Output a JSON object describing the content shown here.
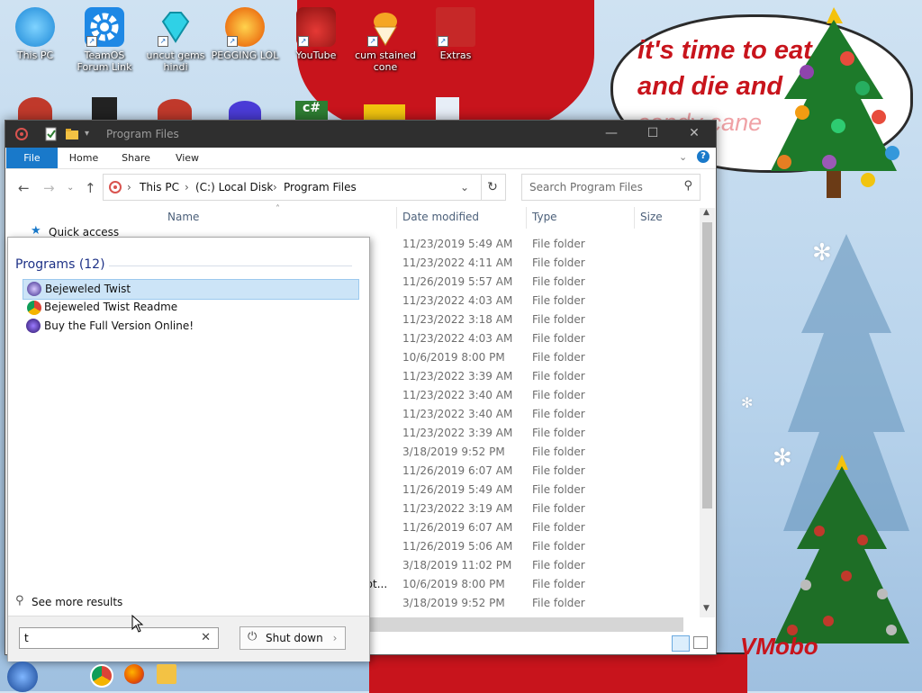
{
  "desktop": {
    "icons": [
      {
        "label": "This PC"
      },
      {
        "label": "TeamOS Forum Link"
      },
      {
        "label": "uncut gems hindi"
      },
      {
        "label": "PEGGING LOL"
      },
      {
        "label": "YouTube"
      },
      {
        "label": "cum stained cone"
      },
      {
        "label": "Extras"
      }
    ],
    "wallpaper_bubble_line1": "it's time to eat it",
    "wallpaper_bubble_line2": "and die and ...",
    "wallpaper_bubble_line3": "candy cane",
    "wallpaper_corner_text": "VMobo",
    "colors": {
      "hat_red": "#c8141c",
      "sky": "#cfe2f2"
    }
  },
  "explorer": {
    "title": "Program Files",
    "ribbon_tabs": [
      {
        "label": "File"
      },
      {
        "label": "Home"
      },
      {
        "label": "Share"
      },
      {
        "label": "View"
      }
    ],
    "address_segments": [
      {
        "label": "This PC"
      },
      {
        "label": "(C:) Local Disk"
      },
      {
        "label": "Program Files"
      }
    ],
    "search_placeholder": "Search Program Files",
    "nav_quick_access": "Quick access",
    "columns": {
      "name": "Name",
      "date": "Date modified",
      "type": "Type",
      "size": "Size"
    },
    "partial_name": "rot...",
    "rows": [
      {
        "date": "11/23/2019 5:49 AM",
        "type": "File folder"
      },
      {
        "date": "11/23/2022 4:11 AM",
        "type": "File folder"
      },
      {
        "date": "11/26/2019 5:57 AM",
        "type": "File folder"
      },
      {
        "date": "11/23/2022 4:03 AM",
        "type": "File folder"
      },
      {
        "date": "11/23/2022 3:18 AM",
        "type": "File folder"
      },
      {
        "date": "11/23/2022 4:03 AM",
        "type": "File folder"
      },
      {
        "date": "10/6/2019 8:00 PM",
        "type": "File folder"
      },
      {
        "date": "11/23/2022 3:39 AM",
        "type": "File folder"
      },
      {
        "date": "11/23/2022 3:40 AM",
        "type": "File folder"
      },
      {
        "date": "11/23/2022 3:40 AM",
        "type": "File folder"
      },
      {
        "date": "11/23/2022 3:39 AM",
        "type": "File folder"
      },
      {
        "date": "3/18/2019 9:52 PM",
        "type": "File folder"
      },
      {
        "date": "11/26/2019 6:07 AM",
        "type": "File folder"
      },
      {
        "date": "11/26/2019 5:49 AM",
        "type": "File folder"
      },
      {
        "date": "11/23/2022 3:19 AM",
        "type": "File folder"
      },
      {
        "date": "11/26/2019 6:07 AM",
        "type": "File folder"
      },
      {
        "date": "11/26/2019 5:06 AM",
        "type": "File folder"
      },
      {
        "date": "3/18/2019 11:02 PM",
        "type": "File folder"
      },
      {
        "date": "10/6/2019 8:00 PM",
        "type": "File folder"
      },
      {
        "date": "3/18/2019 9:52 PM",
        "type": "File folder"
      }
    ]
  },
  "start_search": {
    "section_title": "Programs (12)",
    "programs": [
      {
        "label": "Bejeweled Twist",
        "selected": true
      },
      {
        "label": "Bejeweled Twist Readme",
        "selected": false
      },
      {
        "label": "Buy the Full Version Online!",
        "selected": false
      }
    ],
    "see_more": "See more results",
    "query": "t",
    "shutdown_label": "Shut down"
  },
  "taskbar": {
    "items": [
      {
        "icon": "start-orb-icon"
      },
      {
        "icon": "chrome-icon"
      },
      {
        "icon": "firefox-icon"
      },
      {
        "icon": "file-explorer-icon"
      }
    ]
  }
}
